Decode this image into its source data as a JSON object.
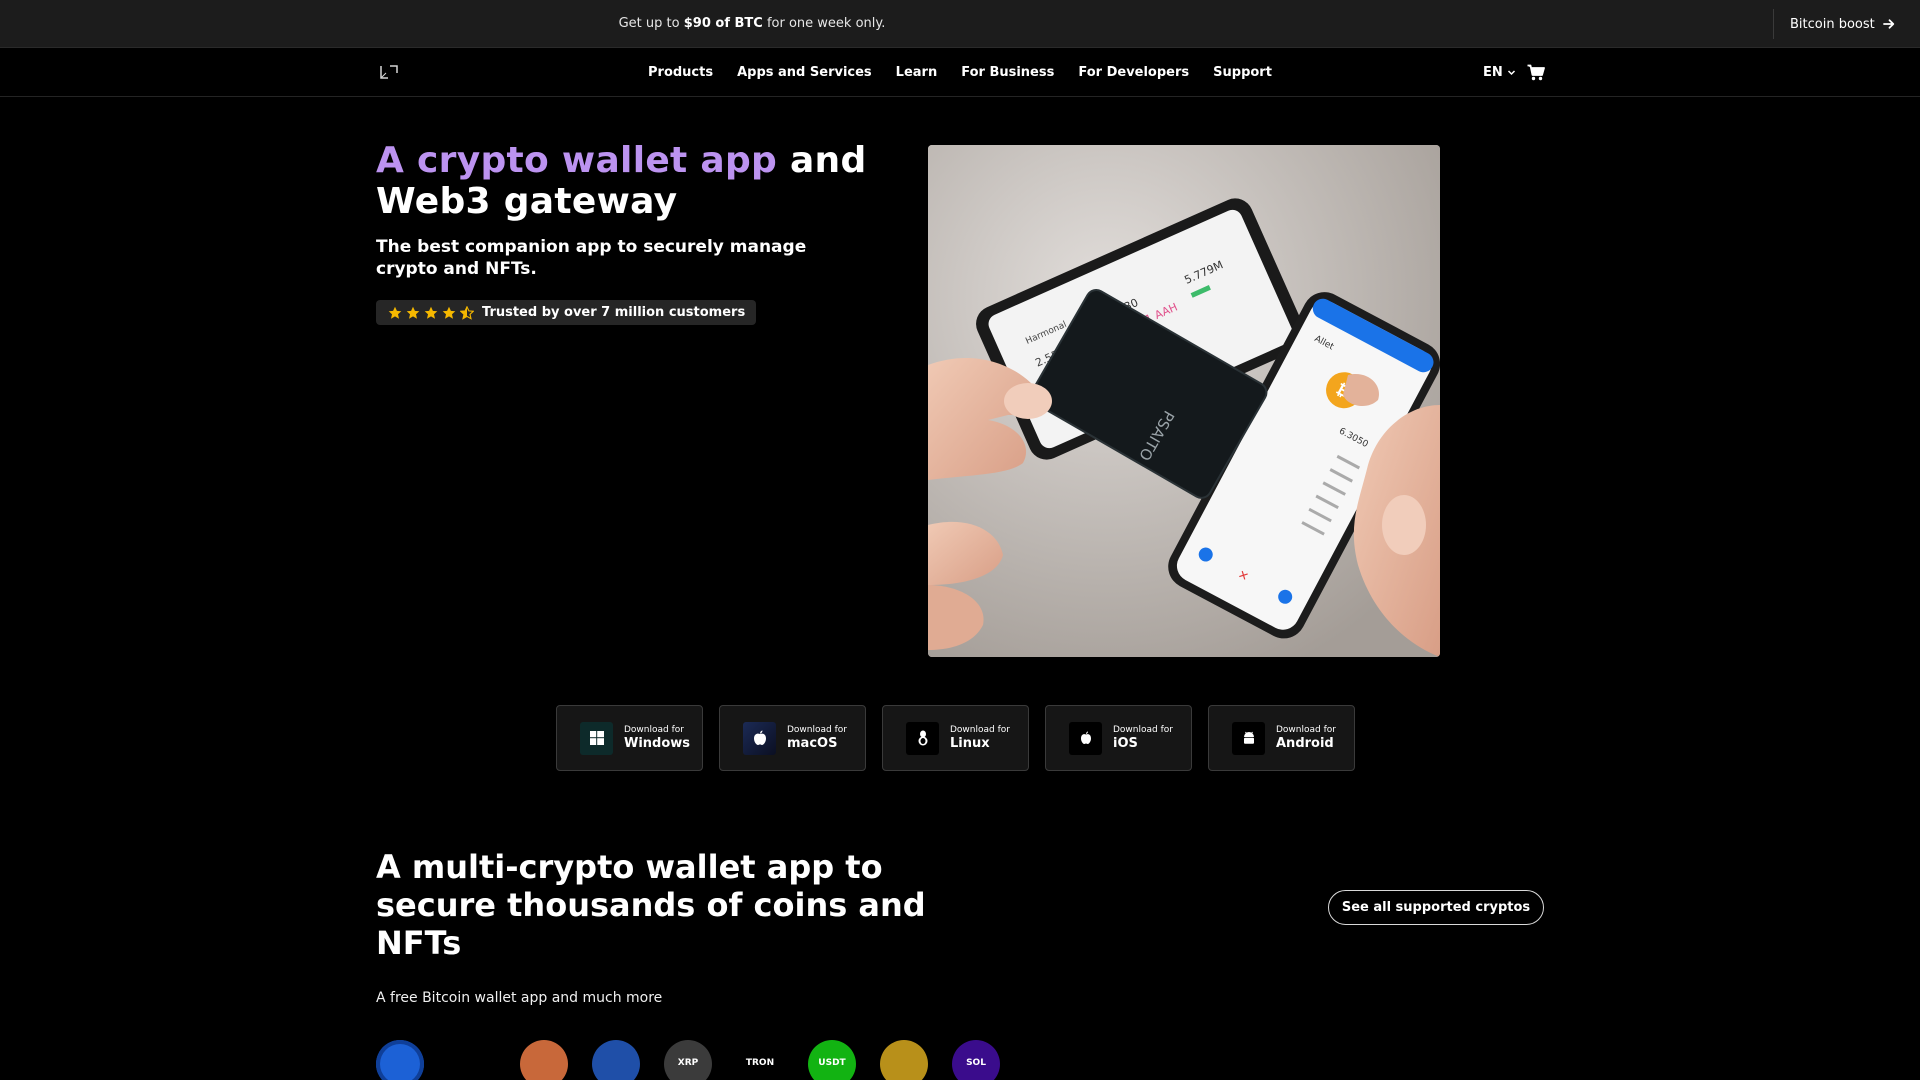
{
  "promo": {
    "text_before": "Get up to",
    "text_bold": "$90 of BTC",
    "text_after": "for one week only.",
    "link_label": "Bitcoin boost"
  },
  "nav": {
    "links": [
      "Products",
      "Apps and Services",
      "Learn",
      "For Business",
      "For Developers",
      "Support"
    ],
    "language": "EN"
  },
  "hero": {
    "title_accent": "A crypto wallet app",
    "title_rest_1": "and",
    "title_rest_2": "Web3 gateway",
    "subtitle": "The best companion app to securely manage crypto and NFTs.",
    "rating_stars": 4.5,
    "trust_text": "Trusted by over 7 million customers",
    "image_brand": "PSAITO"
  },
  "downloads": {
    "prefix": "Download for",
    "platforms": [
      "Windows",
      "macOS",
      "Linux",
      "iOS",
      "Android"
    ]
  },
  "section": {
    "title": "A multi-crypto wallet app to secure thousands of coins and NFTs",
    "subtitle": "A free Bitcoin wallet app and much more",
    "see_all_label": "See all supported cryptos"
  },
  "coins": [
    {
      "name": "dollar-coin",
      "label": "",
      "color": "#1c61d6"
    },
    {
      "name": "ton-coin",
      "label": "",
      "color": "#000000"
    },
    {
      "name": "bitcoin-coin",
      "label": "",
      "color": "#c8683a"
    },
    {
      "name": "ethereum-coin",
      "label": "",
      "color": "#1f4fa8"
    },
    {
      "name": "xrp-coin",
      "label": "XRP",
      "color": "#3b3b3b"
    },
    {
      "name": "tron-coin",
      "label": "TRON",
      "color": "#000000"
    },
    {
      "name": "usdt-coin",
      "label": "USDT",
      "color": "#12b312"
    },
    {
      "name": "bnb-coin",
      "label": "",
      "color": "#b8901a"
    },
    {
      "name": "sol-coin",
      "label": "SOL",
      "color": "#3a0c8c"
    }
  ],
  "colors": {
    "accent_purple": "#bc93f0",
    "promo_bg": "#1c1c1c",
    "star_yellow": "#f5b800"
  }
}
